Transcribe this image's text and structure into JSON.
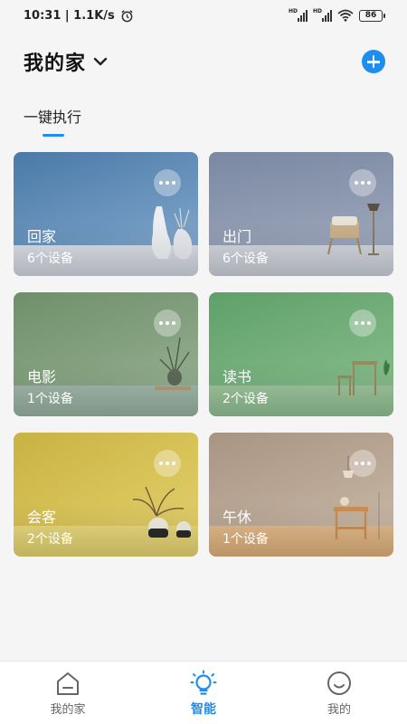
{
  "status_bar": {
    "time_speed": "10:31 | 1.1K/s",
    "battery": "86",
    "hd_label": "HD",
    "icons": [
      "alarm-icon",
      "signal-icon",
      "signal-icon",
      "wifi-icon",
      "battery-icon"
    ]
  },
  "header": {
    "home_name": "我的家",
    "dropdown_icon": "chevron-down-icon",
    "add_icon": "plus-circle-icon"
  },
  "tabs": [
    {
      "label": "一键执行",
      "active": true
    }
  ],
  "scenes": [
    {
      "name": "回家",
      "devices": "6个设备",
      "more_icon": "more-horizontal-icon"
    },
    {
      "name": "出门",
      "devices": "6个设备",
      "more_icon": "more-horizontal-icon"
    },
    {
      "name": "电影",
      "devices": "1个设备",
      "more_icon": "more-horizontal-icon"
    },
    {
      "name": "读书",
      "devices": "2个设备",
      "more_icon": "more-horizontal-icon"
    },
    {
      "name": "会客",
      "devices": "2个设备",
      "more_icon": "more-horizontal-icon"
    },
    {
      "name": "午休",
      "devices": "1个设备",
      "more_icon": "more-horizontal-icon"
    }
  ],
  "bottom_nav": [
    {
      "label": "我的家",
      "icon": "home-icon",
      "active": false
    },
    {
      "label": "智能",
      "icon": "lightbulb-icon",
      "active": true
    },
    {
      "label": "我的",
      "icon": "smiley-icon",
      "active": false
    }
  ],
  "colors": {
    "accent": "#1d8ef0",
    "background": "#f5f5f6"
  }
}
